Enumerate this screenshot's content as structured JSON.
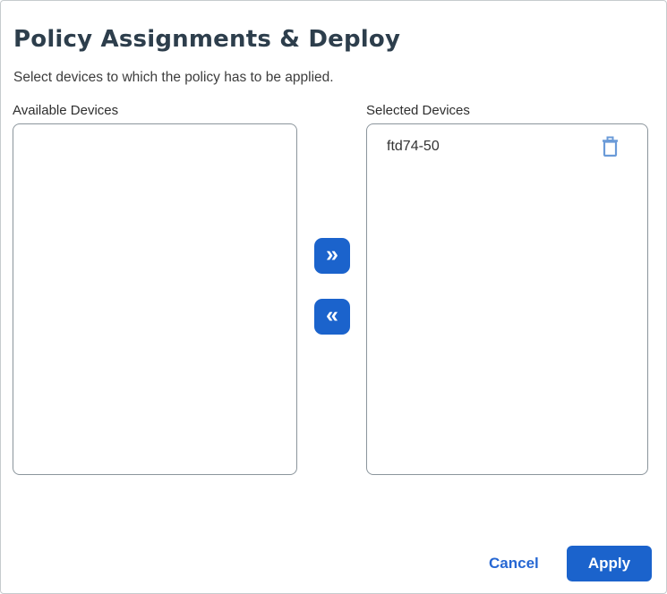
{
  "dialog": {
    "title": "Policy Assignments & Deploy",
    "subtitle": "Select devices to which the policy has to be applied."
  },
  "available_devices": {
    "label": "Available Devices",
    "items": []
  },
  "selected_devices": {
    "label": "Selected Devices",
    "items": [
      {
        "name": "ftd74-50",
        "remove_icon": "trash-icon"
      }
    ]
  },
  "transfer": {
    "move_right_icon": "»",
    "move_left_icon": "«"
  },
  "footer": {
    "cancel_label": "Cancel",
    "apply_label": "Apply"
  },
  "colors": {
    "primary_blue": "#1b63cc",
    "trash_icon_blue": "#6b9bd8",
    "listbox_border": "#8b959c",
    "title_text": "#2d3e4c"
  }
}
